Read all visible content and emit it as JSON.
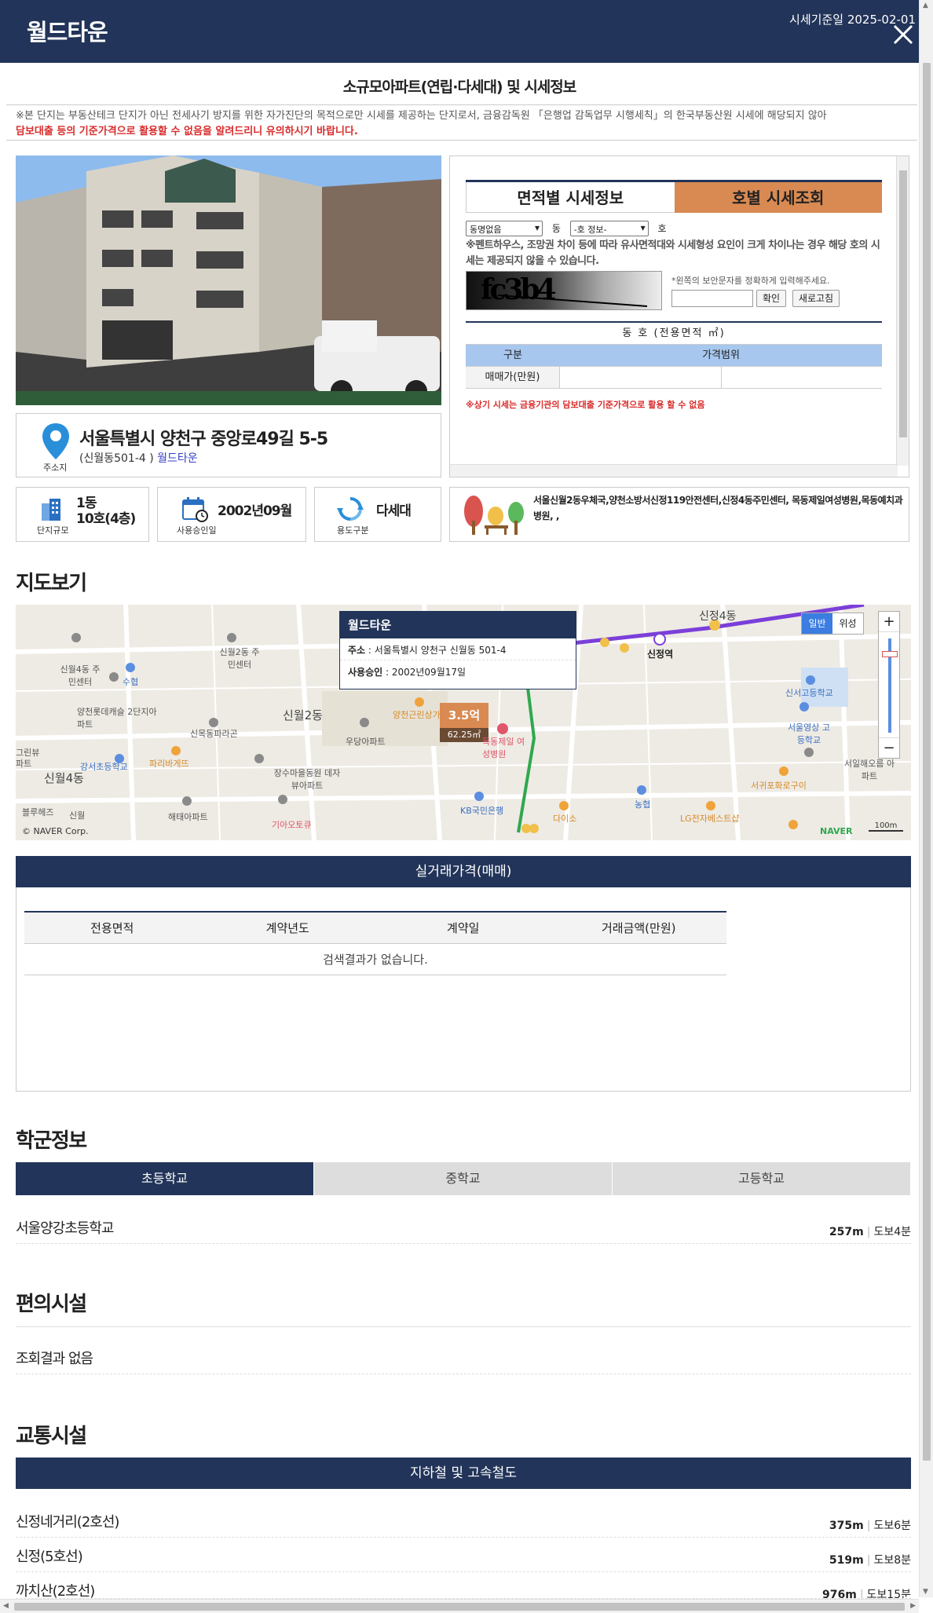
{
  "header": {
    "logo": "월드타운",
    "base_date": "시세기준일 2025-02-01"
  },
  "page_title": "소규모아파트(연립·다세대) 및 시세정보",
  "notice": {
    "line1": "※본 단지는 부동산테크 단지가 아닌 전세사기 방지를 위한 자가진단의 목적으로만 시세를 제공하는 단지로서, 금융감독원 「은행업 감독업무 시행세칙」의 한국부동산원 시세에 해당되지 않아",
    "line2": "담보대출 등의 기준가격으로 활용할 수 없음을 알려드리니 유의하시기 바랍니다."
  },
  "address": {
    "label": "주소지",
    "main": "서울특별시 양천구 중앙로49길 5-5",
    "sub": "(신월동501-4 )",
    "link": "월드타운"
  },
  "info": {
    "scale_label": "단지규모",
    "scale_value_1": "1동",
    "scale_value_2": "10호(4층)",
    "approval_label": "사용승인일",
    "approval_value": "2002년09월",
    "usage_label": "용도구분",
    "usage_value": "다세대",
    "nearby": "서울신월2동우체국,양천소방서신정119안전센터,신정4동주민센터, 목동제일여성병원,목동예치과병원, ,"
  },
  "price_panel": {
    "tab_area": "면적별 시세정보",
    "tab_unit": "호별 시세조회",
    "dong_select": "동명없음",
    "dong_suffix": "동",
    "ho_select": "-호 정보-",
    "ho_suffix": "호",
    "warning": "※펜트하우스, 조망권 차이 등에 따라 유사면적대와 시세형성 요인이 크게 차이나는 경우 해당 호의 시세는 제공되지 않을 수 있습니다.",
    "captcha_text": "fc3b4",
    "captcha_hint": "*왼쪽의 보안문자를 정확하게 입력해주세요.",
    "confirm_btn": "확인",
    "refresh_btn": "새로고침",
    "table_title": "동 호 (전용면적 ㎡)",
    "col_kind": "구분",
    "col_range": "가격범위",
    "row_sale": "매매가(만원)",
    "red_note": "※상기 시세는 금융기관의 담보대출 기준가격으로 활용 할 수 없음"
  },
  "map_section": {
    "title": "지도보기",
    "popup_title": "월드타운",
    "popup_addr_label": "주소",
    "popup_addr": "서울특별시 양천구 신월동 501-4",
    "popup_appr_label": "사용승인",
    "popup_appr": "2002년09월17일",
    "marker_price": "3.5억",
    "marker_area": "62.25㎡",
    "btn_normal": "일반",
    "btn_sat": "위성",
    "zoom_in": "+",
    "zoom_out": "−",
    "copyright": "© NAVER Corp.",
    "naver": "NAVER",
    "scale": "100m",
    "labels": [
      "신월4동 주민센터",
      "수협",
      "신월2동 주민센터",
      "신월2동",
      "양천롯데캐슬 2단지아파트",
      "신목동파라곤",
      "우당아파트",
      "양천근린상가",
      "목동제일 여성병원",
      "신정4동",
      "신정역",
      "신서고등학교",
      "서울영상 고등학교",
      "신월4동",
      "강서초등학교",
      "파리바게뜨",
      "장수마을동원 데자뷰아파트",
      "신월",
      "해태아파트",
      "기아오토큐",
      "KB국민은행",
      "다이소",
      "농협",
      "LG전자베스트샵",
      "서귀포화로구이",
      "서일해오름 아파트",
      "블루헤즈",
      "파트",
      "그린뷰"
    ]
  },
  "deal": {
    "title": "실거래가격(매매)",
    "columns": [
      "전용면적",
      "계약년도",
      "계약일",
      "거래금액(만원)"
    ],
    "empty": "검색결과가 없습니다."
  },
  "school": {
    "title": "학군정보",
    "tabs": [
      "초등학교",
      "중학교",
      "고등학교"
    ],
    "items": [
      {
        "name": "서울양강초등학교",
        "dist": "257m",
        "walk": "도보4분"
      }
    ]
  },
  "convenience": {
    "title": "편의시설",
    "empty": "조회결과 없음"
  },
  "transit": {
    "title": "교통시설",
    "subtitle": "지하철 및 고속철도",
    "items": [
      {
        "name": "신정네거리(2호선)",
        "dist": "375m",
        "walk": "도보6분"
      },
      {
        "name": "신정(5호선)",
        "dist": "519m",
        "walk": "도보8분"
      },
      {
        "name": "까치산(2호선)",
        "dist": "976m",
        "walk": "도보15분"
      }
    ]
  },
  "colors": {
    "navy": "#223459",
    "orange_tab": "#d98a52",
    "light_blue": "#a7c7ee",
    "red_text": "#d92b2b",
    "line5_purple": "#7b3fd9",
    "line2_green": "#2fa84f"
  }
}
